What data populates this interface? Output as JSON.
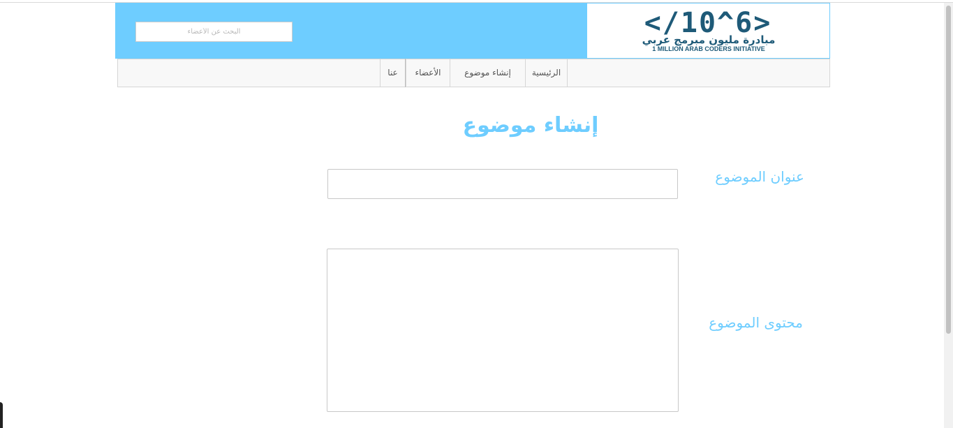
{
  "header": {
    "logo": {
      "symbol": "</10^6>",
      "arabic": "مبادرة مليون مبرمج عربي",
      "english": "1 MILLION ARAB CODERS INITIATIVE"
    },
    "search": {
      "placeholder": "البحث عن الأعضاء",
      "value": ""
    }
  },
  "nav": {
    "items": [
      {
        "label": "الرئيسية"
      },
      {
        "label": "إنشاء موضوع"
      },
      {
        "label": "الأعضاء"
      },
      {
        "label": "عنا"
      }
    ]
  },
  "main": {
    "title": "إنشاء موضوع",
    "form": {
      "title_label": "عنوان الموضوع",
      "title_value": "",
      "content_label": "محتوى الموضوع",
      "content_value": ""
    }
  },
  "colors": {
    "accent": "#6ecdff",
    "logo": "#1e5a78",
    "nav_bg": "#f8f8f8"
  }
}
